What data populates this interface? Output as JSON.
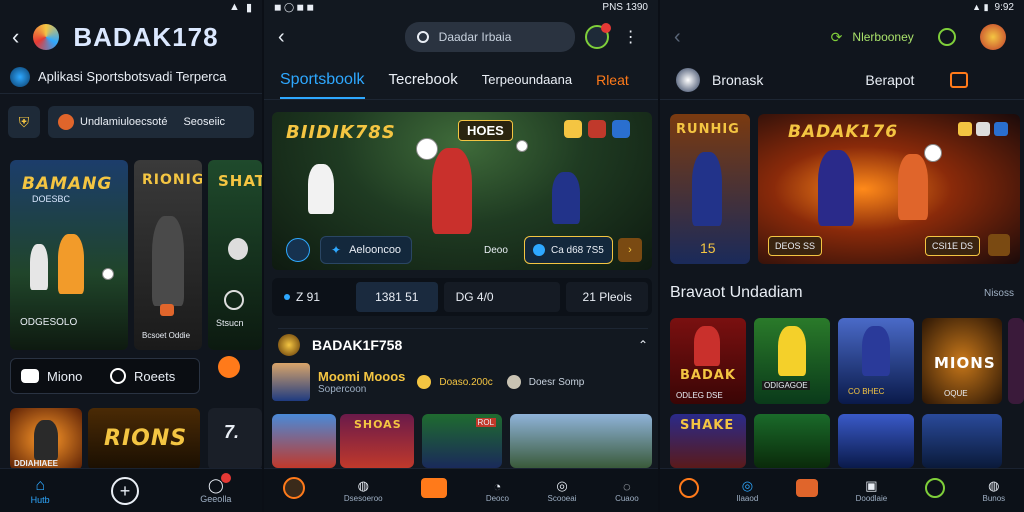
{
  "colors": {
    "accent": "#2ea8ff",
    "gold": "#f4c542",
    "orange": "#ff7a1a",
    "bg": "#10151d"
  },
  "panel1": {
    "status": "",
    "brand": "BADAK178",
    "tagline": "Aplikasi Sportsbotsvadi Terperca",
    "subnav": [
      "Undlamiuloecsoté",
      "Seoseiic"
    ],
    "cards": [
      {
        "title": "BAMANG",
        "subtitle": "DOESBC",
        "label": "ODGESOLO"
      },
      {
        "title": "RIONIG",
        "label": "Bcsoet Oddie"
      },
      {
        "title": "SHAT",
        "label": "Stsucn"
      }
    ],
    "actions": [
      "Miono",
      "Roeets"
    ],
    "promos": [
      {
        "label": "DDIAHIAEE"
      },
      {
        "title": "RIONS"
      },
      {
        "title": "7."
      }
    ],
    "nav": [
      "Hutb",
      "",
      "Geeolla"
    ]
  },
  "panel2": {
    "status": "PNS 1390",
    "search_placeholder": "Daadar Irbaia",
    "tabs": [
      "Sportsboolk",
      "Tecrebook",
      "Terpeoundaana",
      "Rleat"
    ],
    "hero": {
      "title": "BIIDIK78S",
      "badge": "HOES",
      "button_left": "Aelooncoo",
      "button_right_label": "Deoo",
      "button_right": "Ca d68 7S5"
    },
    "scores": [
      "Z 91",
      "1381 51",
      "DG 4/0",
      "21 Pleois"
    ],
    "section_title": "BADAK1F758",
    "featured": {
      "name": "Moomi Mooos",
      "sub": "Sopercoon",
      "odds": "Doaso.200c",
      "extra": "Doesr Somp"
    },
    "thumbs": [
      {
        "label": ""
      },
      {
        "label": "SHOAS"
      },
      {
        "label": "ROL"
      },
      {
        "label": ""
      }
    ],
    "nav": [
      "",
      "Dsesoeroo",
      "",
      "Deoco",
      "Scooeai",
      "Cuaoo"
    ]
  },
  "panel3": {
    "status": "9:92",
    "header_link": "Nlerbooney",
    "top_tabs": [
      "Bronask",
      "Berapot"
    ],
    "banners": [
      {
        "title": "RUNHIG",
        "score": "15"
      },
      {
        "title": "BADAK176",
        "left": "DEOS SS",
        "right": "CSI1E DS"
      }
    ],
    "section_title": "Bravaot Undadiam",
    "section_more": "Nisoss",
    "grid1": [
      {
        "title": "BADAK",
        "sub": "ODLEG DSE"
      },
      {
        "title": "",
        "sub": "ODIGAGOE"
      },
      {
        "title": "",
        "sub": "CO BHEC"
      },
      {
        "title": "MIONS",
        "sub": "OQUE"
      }
    ],
    "grid2": [
      {
        "title": "SHAKE"
      },
      {
        "title": ""
      },
      {
        "title": ""
      },
      {
        "title": ""
      }
    ],
    "nav": [
      "",
      "Ilaaod",
      "",
      "Doodlaie",
      "",
      "Bunos"
    ]
  }
}
